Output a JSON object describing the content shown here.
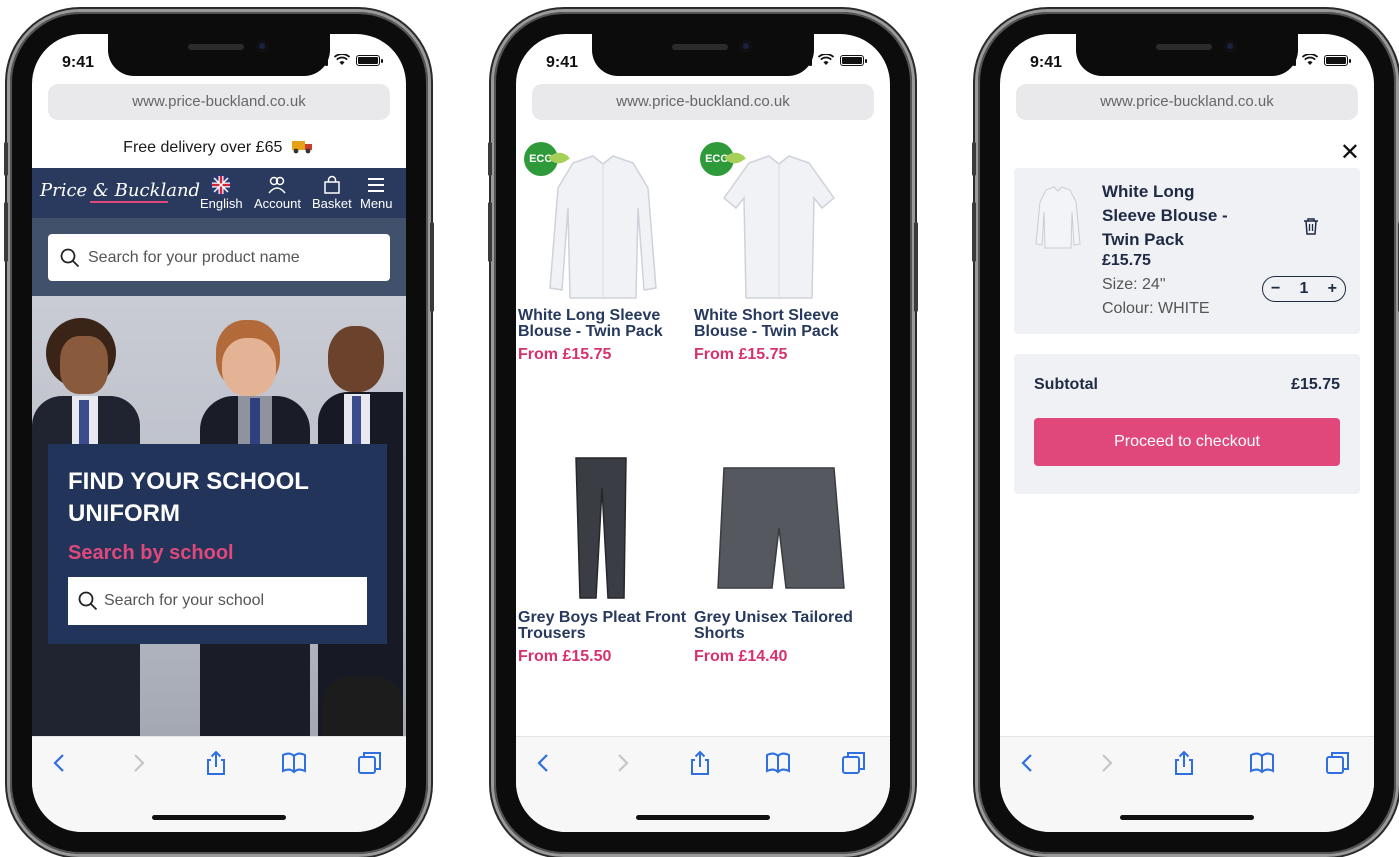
{
  "status_bar": {
    "time": "9:41"
  },
  "browser": {
    "url": "www.price-buckland.co.uk"
  },
  "phone1": {
    "promo": "Free delivery over £65",
    "logo": "Price & Buckland",
    "nav": [
      {
        "label": "English",
        "icon": "uk-flag-icon"
      },
      {
        "label": "Account",
        "icon": "account-icon"
      },
      {
        "label": "Basket",
        "icon": "basket-icon"
      },
      {
        "label": "Menu",
        "icon": "menu-icon"
      }
    ],
    "product_search_placeholder": "Search for your product name",
    "hero": {
      "title": "FIND YOUR SCHOOL UNIFORM",
      "subtitle": "Search by school",
      "school_search_placeholder": "Search for your school"
    }
  },
  "phone2": {
    "products": [
      {
        "name": "White Long Sleeve Blouse - Twin Pack",
        "price": "From £15.75",
        "badge": "ECO"
      },
      {
        "name": "White Short Sleeve Blouse - Twin Pack",
        "price": "From £15.75",
        "badge": "ECO"
      },
      {
        "name": "Grey Boys Pleat Front Trousers",
        "price": "From £15.50"
      },
      {
        "name": "Grey Unisex Tailored Shorts",
        "price": "From £14.40"
      }
    ]
  },
  "phone3": {
    "cart_item": {
      "name": "White Long Sleeve Blouse - Twin Pack",
      "price": "£15.75",
      "size": "Size: 24\"",
      "colour": "Colour: WHITE",
      "quantity": "1"
    },
    "subtotal_label": "Subtotal",
    "subtotal_value": "£15.75",
    "checkout_label": "Proceed to checkout"
  },
  "colors": {
    "navy": "#293a5e",
    "pink": "#e0487c",
    "panel": "#eff1f4"
  }
}
